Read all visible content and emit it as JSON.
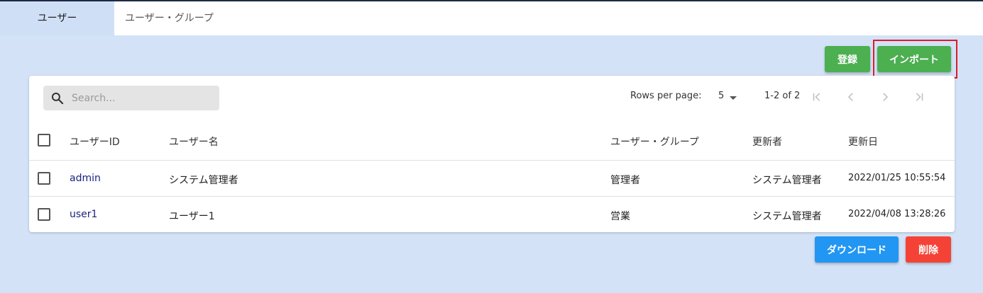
{
  "tabs": [
    {
      "label": "ユーザー"
    },
    {
      "label": "ユーザー・グループ"
    }
  ],
  "toolbar": {
    "register_label": "登録",
    "import_label": "インポート"
  },
  "search": {
    "placeholder": "Search..."
  },
  "pagination": {
    "rows_per_page_label": "Rows per page:",
    "rows_per_page_value": "5",
    "range_text": "1-2 of 2"
  },
  "table": {
    "headers": [
      "ユーザーID",
      "ユーザー名",
      "ユーザー・グループ",
      "更新者",
      "更新日"
    ],
    "rows": [
      {
        "id": "admin",
        "name": "システム管理者",
        "group": "管理者",
        "updated_by": "システム管理者",
        "updated_at": "2022/01/25 10:55:54"
      },
      {
        "id": "user1",
        "name": "ユーザー1",
        "group": "営業",
        "updated_by": "システム管理者",
        "updated_at": "2022/04/08 13:28:26"
      }
    ]
  },
  "footer": {
    "download_label": "ダウンロード",
    "delete_label": "削除"
  },
  "colors": {
    "background": "#d3e2f7",
    "green": "#4caf50",
    "blue": "#2196f3",
    "red": "#f44336",
    "highlight": "#e01a2b",
    "link": "#1a237e"
  },
  "icons": [
    "search-icon",
    "caret-down-icon",
    "first-page-icon",
    "prev-page-icon",
    "next-page-icon",
    "last-page-icon"
  ]
}
